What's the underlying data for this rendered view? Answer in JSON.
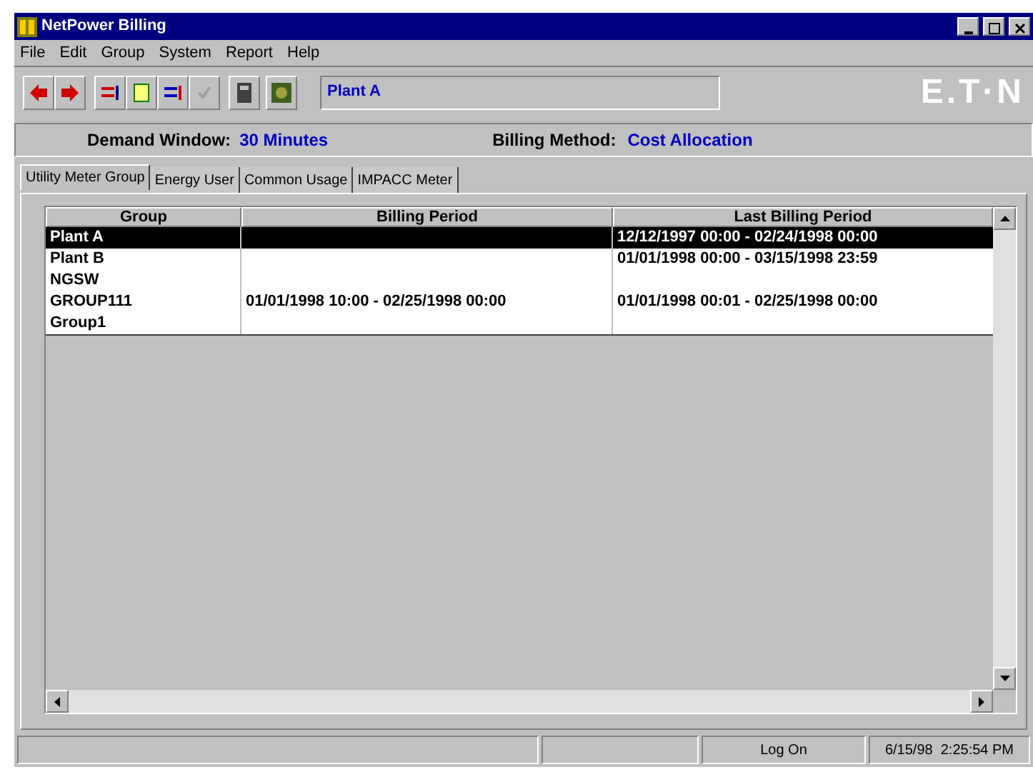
{
  "window": {
    "title": "NetPower Billing"
  },
  "menu": [
    "File",
    "Edit",
    "Group",
    "System",
    "Report",
    "Help"
  ],
  "toolbar": {
    "field_value": "Plant A",
    "logo": "E.T·N"
  },
  "info": {
    "demand_label": "Demand Window:",
    "demand_value": "30 Minutes",
    "billing_label": "Billing Method:",
    "billing_value": "Cost Allocation"
  },
  "tabs": [
    {
      "label": "Utility Meter Group",
      "selected": true
    },
    {
      "label": "Energy User",
      "selected": false
    },
    {
      "label": "Common Usage",
      "selected": false
    },
    {
      "label": "IMPACC Meter",
      "selected": false
    }
  ],
  "table": {
    "columns": [
      "Group",
      "Billing Period",
      "Last Billing Period"
    ],
    "rows": [
      {
        "cells": [
          "Plant A",
          "",
          "12/12/1997 00:00 - 02/24/1998 00:00"
        ],
        "selected": true
      },
      {
        "cells": [
          "Plant B",
          "",
          "01/01/1998 00:00 - 03/15/1998 23:59"
        ],
        "selected": false
      },
      {
        "cells": [
          "NGSW",
          "",
          ""
        ],
        "selected": false
      },
      {
        "cells": [
          "GROUP111",
          "01/01/1998 10:00 - 02/25/1998 00:00",
          "01/01/1998 00:01 - 02/25/1998 00:00"
        ],
        "selected": false
      },
      {
        "cells": [
          "Group1",
          "",
          ""
        ],
        "selected": false
      }
    ]
  },
  "status_bar": {
    "login": "Log On",
    "datetime": "6/15/98  2:25:54 PM"
  }
}
